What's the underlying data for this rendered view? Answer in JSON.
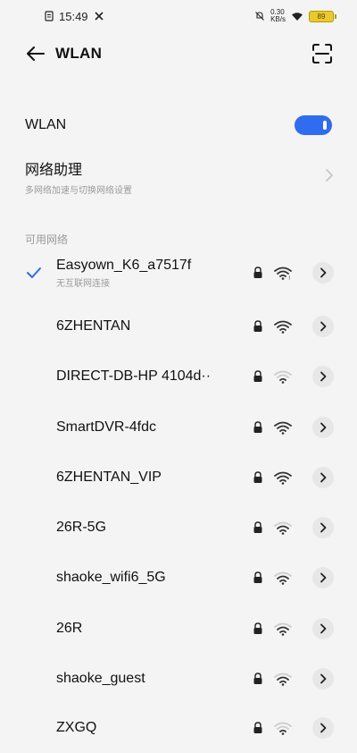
{
  "status": {
    "time": "15:49",
    "net_speed": "0.30\nKB/s",
    "battery": "89"
  },
  "header": {
    "title": "WLAN"
  },
  "wlan": {
    "label": "WLAN",
    "enabled": true
  },
  "assistant": {
    "title": "网络助理",
    "subtitle": "多网络加速与切换网络设置"
  },
  "section": {
    "available_label": "可用网络"
  },
  "networks": [
    {
      "name": "Easyown_K6_a7517f",
      "status": "无互联网连接",
      "connected": true
    },
    {
      "name": "6ZHENTAN"
    },
    {
      "name": "DIRECT-DB-HP 4104d··"
    },
    {
      "name": "SmartDVR-4fdc"
    },
    {
      "name": "6ZHENTAN_VIP"
    },
    {
      "name": "26R-5G"
    },
    {
      "name": "shaoke_wifi6_5G"
    },
    {
      "name": "26R"
    },
    {
      "name": "shaoke_guest"
    },
    {
      "name": "ZXGQ"
    }
  ],
  "colors": {
    "accent": "#2f6cf0"
  }
}
